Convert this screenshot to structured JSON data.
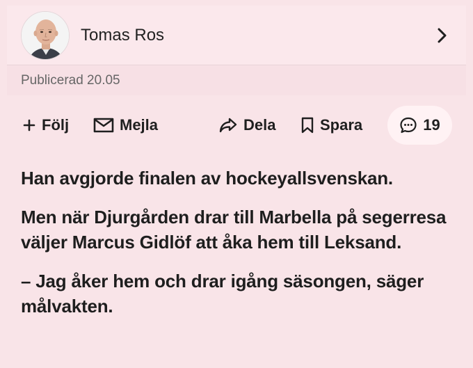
{
  "author": {
    "name": "Tomas Ros",
    "avatar_icon": "author-photo",
    "chevron_icon": "chevron-right-icon"
  },
  "published": "Publicerad 20.05",
  "actions": {
    "follow": {
      "label": "Följ",
      "icon": "plus-icon"
    },
    "mail": {
      "label": "Mejla",
      "icon": "mail-icon"
    },
    "share": {
      "label": "Dela",
      "icon": "share-arrow-icon"
    },
    "save": {
      "label": "Spara",
      "icon": "bookmark-icon"
    },
    "comments": {
      "count": "19",
      "icon": "comment-bubble-icon"
    }
  },
  "article": {
    "paragraphs": [
      "Han avgjorde finalen av hockeyallsvenskan.",
      "Men när Djurgården drar till Marbella på segerresa väljer Marcus Gidlöf att åka hem till Leksand.",
      "– Jag åker hem och drar igång säsongen, säger målvakten."
    ]
  },
  "colors": {
    "background": "#f9e4e8",
    "card": "#fbe8ec",
    "text": "#1c1c1c",
    "muted": "#666666"
  }
}
